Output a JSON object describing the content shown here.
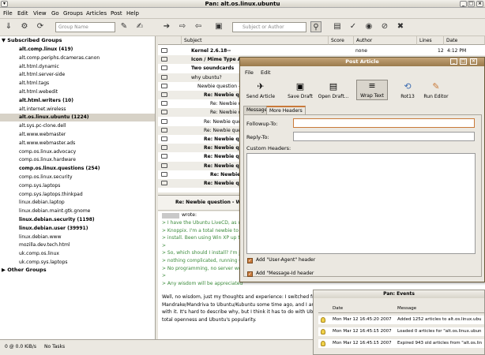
{
  "window": {
    "title": "Pan: alt.os.linux.ubuntu"
  },
  "menubar": [
    "File",
    "Edit",
    "View",
    "Go",
    "Groups",
    "Articles",
    "Post",
    "Help"
  ],
  "toolbar": {
    "group_search_placeholder": "Group Name",
    "subject_search_placeholder": "Subject or Author"
  },
  "groups": {
    "subscribed_header": "Subscribed Groups",
    "other_header": "Other Groups",
    "items": [
      {
        "label": "alt.comp.linux (419)",
        "bold": true
      },
      {
        "label": "alt.comp.periphs.dcameras.canon",
        "bold": false
      },
      {
        "label": "alt.html.dynamic",
        "bold": false
      },
      {
        "label": "alt.html.server-side",
        "bold": false
      },
      {
        "label": "alt.html.tags",
        "bold": false
      },
      {
        "label": "alt.html.webedit",
        "bold": false
      },
      {
        "label": "alt.html.writers (10)",
        "bold": true
      },
      {
        "label": "alt.internet.wireless",
        "bold": false
      },
      {
        "label": "alt.os.linux.ubuntu (1224)",
        "bold": true,
        "selected": true
      },
      {
        "label": "alt.sys.pc-clone.dell",
        "bold": false
      },
      {
        "label": "alt.www.webmaster",
        "bold": false
      },
      {
        "label": "alt.www.webmaster.ads",
        "bold": false
      },
      {
        "label": "comp.os.linux.advocacy",
        "bold": false
      },
      {
        "label": "comp.os.linux.hardware",
        "bold": false
      },
      {
        "label": "comp.os.linux.questions (254)",
        "bold": true
      },
      {
        "label": "comp.os.linux.security",
        "bold": false
      },
      {
        "label": "comp.sys.laptops",
        "bold": false
      },
      {
        "label": "comp.sys.laptops.thinkpad",
        "bold": false
      },
      {
        "label": "linux.debian.laptop",
        "bold": false
      },
      {
        "label": "linux.debian.maint.gtk.gnome",
        "bold": false
      },
      {
        "label": "linux.debian.security (1198)",
        "bold": true
      },
      {
        "label": "linux.debian.user (39991)",
        "bold": true
      },
      {
        "label": "linux.debian.www",
        "bold": false
      },
      {
        "label": "mozilla.dev.tech.html",
        "bold": false
      },
      {
        "label": "uk.comp.os.linux",
        "bold": false
      },
      {
        "label": "uk.comp.sys.laptops",
        "bold": false
      }
    ]
  },
  "headers": {
    "columns": {
      "subject": "Subject",
      "score": "Score",
      "author": "Author",
      "lines": "Lines",
      "date": "Date"
    },
    "rows": [
      {
        "subject": "Kernel 2.6.18--",
        "bold": true,
        "indent": 0,
        "score": "",
        "author": "none",
        "lines": "12",
        "date": "4:12 PM"
      },
      {
        "subject": "Icon / Mime Type A",
        "bold": true,
        "indent": 0
      },
      {
        "subject": "Two soundcards",
        "bold": true,
        "indent": 0
      },
      {
        "subject": "why ubuntu?",
        "bold": false,
        "indent": 0
      },
      {
        "subject": "Newbie question - W",
        "bold": false,
        "indent": 1
      },
      {
        "subject": "Re: Newbie que",
        "bold": true,
        "indent": 2
      },
      {
        "subject": "Re: Newbie q",
        "bold": false,
        "indent": 3
      },
      {
        "subject": "Re: Newbie q",
        "bold": false,
        "indent": 3
      },
      {
        "subject": "Re: Newbie que",
        "bold": false,
        "indent": 2
      },
      {
        "subject": "Re: Newbie ques",
        "bold": false,
        "indent": 2
      },
      {
        "subject": "Re: Newbie ques",
        "bold": true,
        "indent": 2
      },
      {
        "subject": "Re: Newbie ques",
        "bold": true,
        "indent": 2
      },
      {
        "subject": "Re: Newbie ques",
        "bold": true,
        "indent": 2
      },
      {
        "subject": "Re: Newbie ques",
        "bold": true,
        "indent": 2
      },
      {
        "subject": "Re: Newbie",
        "bold": true,
        "indent": 3
      },
      {
        "subject": "Re: Newbie ques",
        "bold": true,
        "indent": 2
      }
    ]
  },
  "body": {
    "header_subject": "Re: Newbie question - Why U",
    "wrote": "wrote:",
    "quotes": [
      "> I have the Ubuntu LiveCD, as we",
      "> Knoppix.  I'm a total newbie to L",
      "> install.  Been using Win XP up t",
      ">",
      "> So, which should I install?  I'm ju",
      "> nothing complicated, running Of",
      "> No programming, no server work",
      ">",
      "> Any wisdom will be appreciated"
    ],
    "reply": [
      "Well, no wisdom, just my thoughts and experience: I switched from",
      "Mandrake/Mandriva to Ubuntu/Kubuntu some time ago, and I am v",
      "with it. It's hard to describe why, but I think it has to do with Ubu",
      "total openness and Ubuntu's popularity."
    ]
  },
  "status": {
    "rate": "0 @ 0.0 KiB/s",
    "tasks": "No Tasks"
  },
  "dialog": {
    "title": "Post Article",
    "menu": [
      "File",
      "Edit"
    ],
    "toolbar": [
      "Send Article",
      "Save Draft",
      "Open Draft...",
      "Wrap Text",
      "Rot13",
      "Run Editor"
    ],
    "tabs": [
      "Message",
      "More Headers"
    ],
    "followup_label": "Followup-To:",
    "replyto_label": "Reply-To:",
    "custom_label": "Custom Headers:",
    "cb_user_agent": "Add \"User-Agent\" header",
    "cb_message_id": "Add \"Message-Id header"
  },
  "events": {
    "title": "Pan: Events",
    "col_date": "Date",
    "col_message": "Message",
    "rows": [
      {
        "date": "Mon Mar 12 16:45:20 2007",
        "message": "Added 1252 articles to alt.os.linux.ubu"
      },
      {
        "date": "Mon Mar 12 16:45:15 2007",
        "message": "Loaded 0 articles for \"alt.os.linux.ubun"
      },
      {
        "date": "Mon Mar 12 16:45:15 2007",
        "message": "Expired 943 old articles from \"alt.os.lin"
      }
    ]
  }
}
